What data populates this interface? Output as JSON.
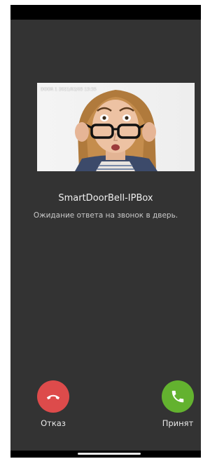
{
  "call": {
    "caller_name": "SmartDoorBell-IPBox",
    "status_text": "Ожидание ответа на звонок в дверь.",
    "snapshot_stamp": "DOOR 1 2021/02/03 13:35"
  },
  "actions": {
    "decline_label": "Отказ",
    "accept_label": "Принят"
  },
  "colors": {
    "background": "#333333",
    "decline": "#dd4b4b",
    "accept": "#63b22f"
  },
  "icons": {
    "decline": "phone-hangup-icon",
    "accept": "phone-answer-icon"
  }
}
